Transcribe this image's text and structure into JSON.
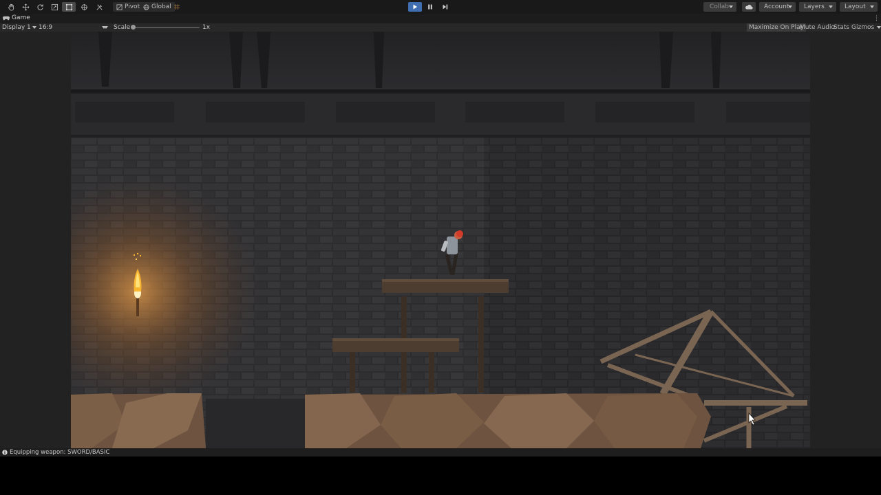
{
  "toolbar": {
    "pivot_label": "Pivot",
    "global_label": "Global",
    "collab_label": "Collab",
    "account_label": "Account",
    "layers_label": "Layers",
    "layout_label": "Layout"
  },
  "game_view": {
    "tab_label": "Game",
    "display_label": "Display 1",
    "aspect_label": "16:9",
    "scale_label": "Scale",
    "scale_value": "1x",
    "maximize_label": "Maximize On Play",
    "mute_label": "Mute Audio",
    "stats_label": "Stats",
    "gizmos_label": "Gizmos"
  },
  "console": {
    "message": "Equipping weapon: SWORD/BASIC"
  },
  "colors": {
    "play_accent": "#3f6fb0",
    "wall": "#2e2e31",
    "ground": "#7a5e45",
    "torch_glow": "#f5a623"
  }
}
